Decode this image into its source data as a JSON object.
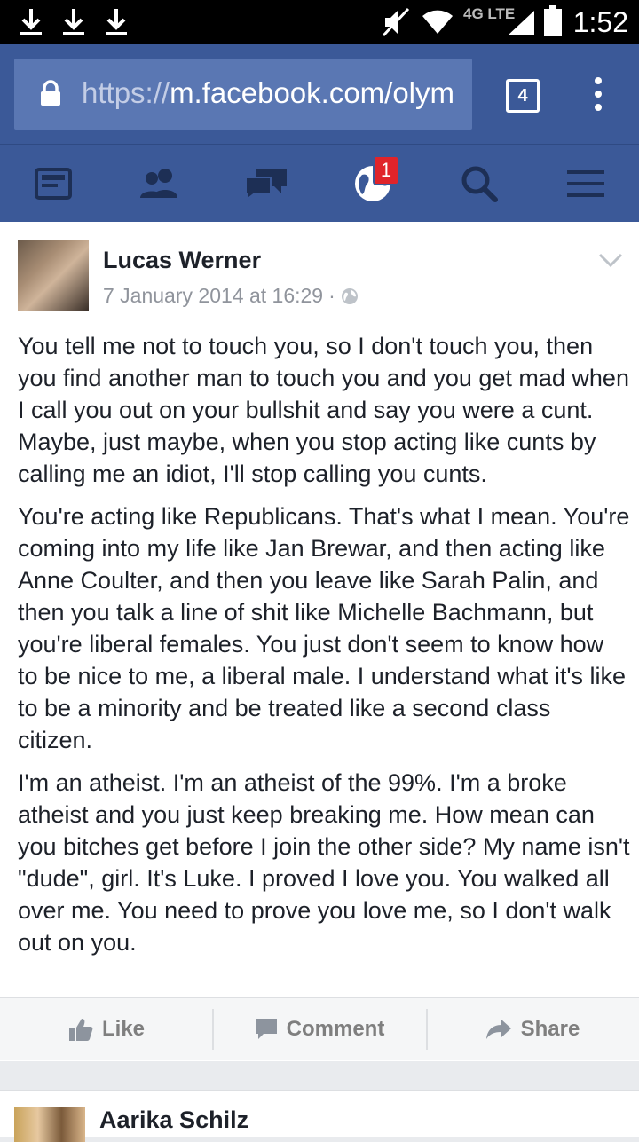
{
  "status_bar": {
    "time": "1:52",
    "network": "4G LTE"
  },
  "browser": {
    "url_prefix": "https://",
    "url_rest": "m.facebook.com/olym",
    "tab_count": "4"
  },
  "nav": {
    "notification_count": "1"
  },
  "post": {
    "author": "Lucas Werner",
    "date": "7 January 2014 at 16:29",
    "separator": "·",
    "paragraphs": [
      "You tell me not to touch you, so I don't touch you, then you find another man to touch you and you get mad when I call you out on your bullshit and say you were a cunt. Maybe, just maybe, when you stop acting like cunts by calling me an idiot, I'll stop calling you cunts.",
      "You're acting like Republicans. That's what I mean. You're coming into my life like Jan Brewar, and then acting like Anne Coulter, and then you leave like Sarah Palin, and then you talk a line of shit like Michelle Bachmann, but you're liberal females. You just don't seem to know how to be nice to me, a liberal male. I understand what it's like to be a minority and be treated like a second class citizen.",
      "I'm an atheist. I'm an atheist of the 99%. I'm a broke atheist and you just keep breaking me. How mean can you bitches get before I join the other side? My name isn't \"dude\", girl. It's Luke. I proved I love you. You walked all over me. You need to prove you love me, so I don't walk out on you."
    ],
    "actions": {
      "like": "Like",
      "comment": "Comment",
      "share": "Share"
    }
  },
  "next_post": {
    "author": "Aarika Schilz"
  },
  "colors": {
    "facebook_blue": "#3b5998",
    "text": "#1d2129",
    "muted": "#90949c",
    "badge": "#e0242a"
  }
}
